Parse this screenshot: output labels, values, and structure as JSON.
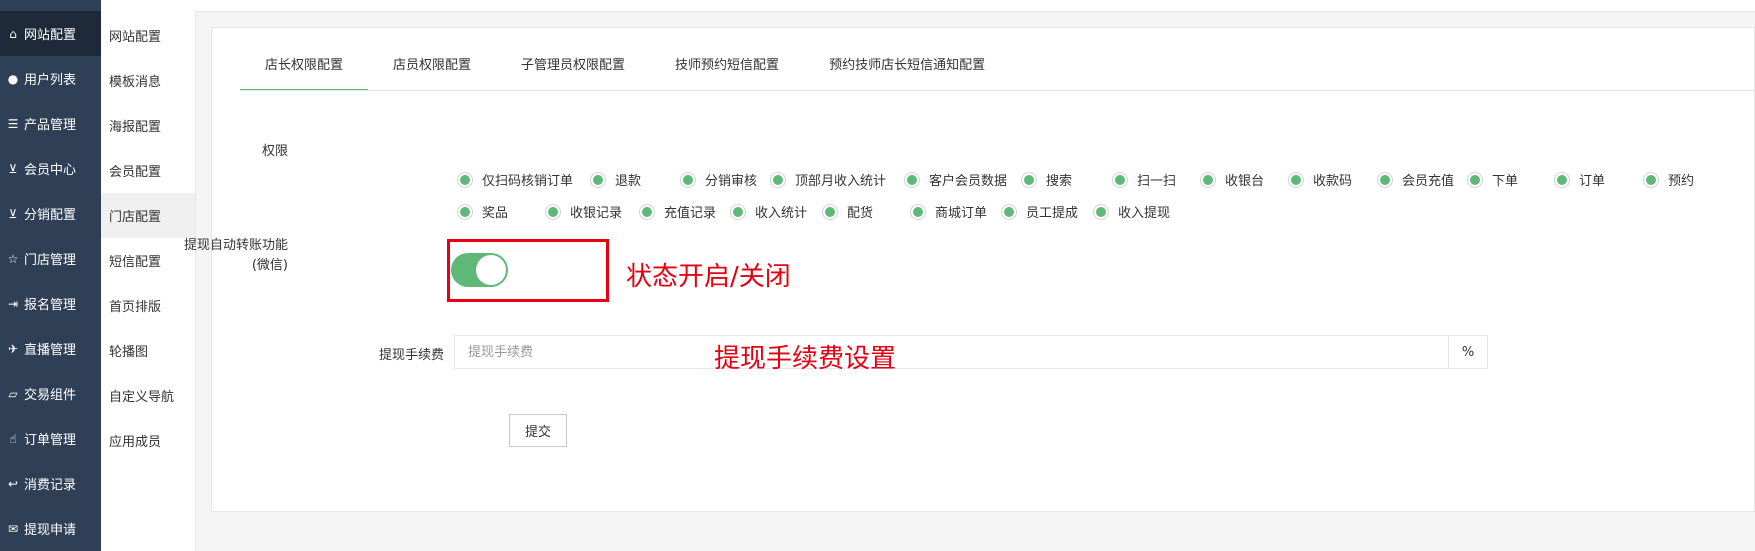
{
  "sidebar": {
    "items": [
      {
        "icon": "home-icon",
        "glyph": "⌂",
        "label": "网站配置"
      },
      {
        "icon": "user-icon",
        "glyph": "●",
        "label": "用户列表"
      },
      {
        "icon": "list-icon",
        "glyph": "☰",
        "label": "产品管理"
      },
      {
        "icon": "cart-icon",
        "glyph": "⊻",
        "label": "会员中心"
      },
      {
        "icon": "cart-icon",
        "glyph": "⊻",
        "label": "分销配置"
      },
      {
        "icon": "star-icon",
        "glyph": "☆",
        "label": "门店管理"
      },
      {
        "icon": "sign-in-icon",
        "glyph": "⇥",
        "label": "报名管理"
      },
      {
        "icon": "plane-icon",
        "glyph": "✈",
        "label": "直播管理"
      },
      {
        "icon": "eraser-icon",
        "glyph": "▱",
        "label": "交易组件"
      },
      {
        "icon": "thumbs-up-icon",
        "glyph": "☝",
        "label": "订单管理"
      },
      {
        "icon": "reply-icon",
        "glyph": "↩",
        "label": "消费记录"
      },
      {
        "icon": "wechat-icon",
        "glyph": "✉",
        "label": "提现申请"
      }
    ]
  },
  "subnav": {
    "items": [
      "网站配置",
      "模板消息",
      "海报配置",
      "会员配置",
      "门店配置",
      "短信配置",
      "首页排版",
      "轮播图",
      "自定义导航",
      "应用成员"
    ]
  },
  "tabs": [
    "店长权限配置",
    "店员权限配置",
    "子管理员权限配置",
    "技师预约短信配置",
    "预约技师店长短信通知配置"
  ],
  "form": {
    "permissions_label": "权限",
    "permissions": [
      "仅扫码核销订单",
      "退款",
      "分销审核",
      "顶部月收入统计",
      "客户会员数据",
      "搜索",
      "扫一扫",
      "收银台",
      "收款码",
      "会员充值",
      "下单",
      "订单",
      "预约",
      "奖品",
      "收银记录",
      "充值记录",
      "收入统计",
      "配货",
      "商城订单",
      "员工提成",
      "收入提现"
    ],
    "withdraw_auto_label": "提现自动转账功能",
    "withdraw_auto_sub": "(微信)",
    "withdraw_auto_enabled": true,
    "fee_label": "提现手续费",
    "fee_placeholder": "提现手续费",
    "fee_value": "",
    "fee_suffix": "%",
    "submit_label": "提交"
  },
  "annotations": {
    "switch_note": "状态开启/关闭",
    "fee_note": "提现手续费设置"
  },
  "colors": {
    "sidebar": "#2f4056",
    "accent": "#5fb878",
    "annotation": "#e60012"
  }
}
